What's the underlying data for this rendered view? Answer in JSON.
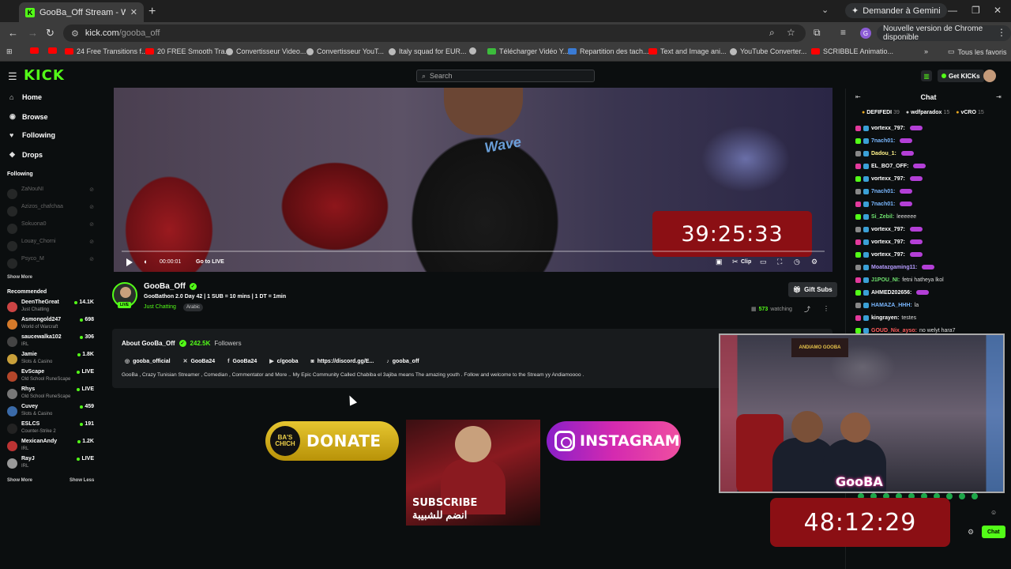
{
  "browser": {
    "tab_title": "GooBa_Off Stream - Watch Live",
    "tab_favicon": "K",
    "gemini_label": "Demander à Gemini",
    "url_host": "kick.com",
    "url_path": "/gooba_off",
    "profile_initial": "G",
    "update_label": "Nouvelle version de Chrome disponible",
    "bookmarks": [
      "24 Free Transitions f...",
      "20 FREE Smooth Tra...",
      "Convertisseur Video...",
      "Convertisseur YouT...",
      "Italy squad for EUR...",
      "Télécharger Vidéo Y...",
      "Repartition des tach...",
      "Text and Image ani...",
      "YouTube Converter...",
      "SCRIBBLE Animatio..."
    ],
    "all_bookmarks": "Tous les favoris"
  },
  "kick": {
    "logo": "KICK",
    "search_placeholder": "Search",
    "get_kicks": "Get KICKs"
  },
  "sidebar": {
    "nav": [
      {
        "icon": "⌂",
        "label": "Home"
      },
      {
        "icon": "◉",
        "label": "Browse"
      },
      {
        "icon": "♥",
        "label": "Following"
      },
      {
        "icon": "◆",
        "label": "Drops"
      }
    ],
    "following_title": "Following",
    "following": [
      {
        "name": "ZaNouNI"
      },
      {
        "name": "Azizos_chafchaa"
      },
      {
        "name": "Sokuona0"
      },
      {
        "name": "Louay_Chorni"
      },
      {
        "name": "Psyco_M"
      }
    ],
    "show_more": "Show More",
    "recommended_title": "Recommended",
    "recommended": [
      {
        "name": "DeenTheGreat",
        "category": "Just Chatting",
        "viewers": "14.1K",
        "color": "#c44"
      },
      {
        "name": "Asmongold247",
        "category": "World of Warcraft",
        "viewers": "698",
        "color": "#d57a2a"
      },
      {
        "name": "saucewalka102",
        "category": "IRL",
        "viewers": "306",
        "color": "#444"
      },
      {
        "name": "Jamie",
        "category": "Slots & Casino",
        "viewers": "1.8K",
        "color": "#c9a03a"
      },
      {
        "name": "EvScape",
        "category": "Old School RuneScape",
        "viewers": "LIVE",
        "color": "#b4462a"
      },
      {
        "name": "Rhys",
        "category": "Old School RuneScape",
        "viewers": "LIVE",
        "color": "#777"
      },
      {
        "name": "Cuvey",
        "category": "Slots & Casino",
        "viewers": "459",
        "color": "#3a6aa8"
      },
      {
        "name": "ESLCS",
        "category": "Counter-Strike 2",
        "viewers": "191",
        "color": "#222"
      },
      {
        "name": "MexicanAndy",
        "category": "IRL",
        "viewers": "1.2K",
        "color": "#b33"
      },
      {
        "name": "RayJ",
        "category": "IRL",
        "viewers": "LIVE",
        "color": "#999"
      }
    ],
    "show_more_2": "Show More",
    "show_less": "Show Less"
  },
  "player": {
    "shirt_text": "Wave",
    "timer": "39:25:33",
    "time": "00:00:01",
    "go_live": "Go to LIVE",
    "clip": "Clip"
  },
  "channel": {
    "name": "GooBa_Off",
    "live_badge": "LIVE",
    "title": "GooBathon 2.0 Day 42 | 1 SUB = 10 mins | 1 DT = 1min",
    "category": "Just Chatting",
    "tag": "Arabic",
    "gift_subs": "Gift Subs",
    "watching_count": "573",
    "watching_label": "watching"
  },
  "about": {
    "title": "About GooBa_Off",
    "followers_count": "242.5K",
    "followers_label": "Followers",
    "socials": [
      {
        "icon": "◎",
        "label": "gooba_official"
      },
      {
        "icon": "✕",
        "label": "GooBa24"
      },
      {
        "icon": "f",
        "label": "GooBa24"
      },
      {
        "icon": "▶",
        "label": "c/gooba"
      },
      {
        "icon": "◙",
        "label": "https://discord.gg/E..."
      },
      {
        "icon": "♪",
        "label": "gooba_off"
      }
    ],
    "bio": "GooBa , Crazy Tunisian Streamer , Comedian , Commentator and More .. My Epic Community Called Chabiba el 3ajiba means The amazing youth . Follow and welcome to the Stream yy Andiamoooo ."
  },
  "panels": {
    "donate_logo": "BA'S CHICH",
    "donate": "DONATE",
    "subscribe": "SUBSCRIBE",
    "subscribe_ar": "انضم للشبيبة",
    "instagram": "INSTAGRAM"
  },
  "chat": {
    "title": "Chat",
    "leaders": [
      {
        "name": "DEFIFEDI",
        "count": "39"
      },
      {
        "name": "wdfparadox",
        "count": "15"
      },
      {
        "name": "vCRO",
        "count": "15"
      }
    ],
    "messages": [
      {
        "user": "vortexx_797:",
        "color": "#fff",
        "text": ""
      },
      {
        "user": "7nach01:",
        "color": "#7ab8ff",
        "text": ""
      },
      {
        "user": "Dadou_1:",
        "color": "#fff38a",
        "text": ""
      },
      {
        "user": "EL_BO7_OFF:",
        "color": "#fff",
        "text": ""
      },
      {
        "user": "vortexx_797:",
        "color": "#fff",
        "text": ""
      },
      {
        "user": "7nach01:",
        "color": "#7ab8ff",
        "text": ""
      },
      {
        "user": "7nach01:",
        "color": "#7ab8ff",
        "text": ""
      },
      {
        "user": "Si_Zebil:",
        "color": "#6fe36f",
        "text": "leeeeee"
      },
      {
        "user": "vortexx_797:",
        "color": "#fff",
        "text": ""
      },
      {
        "user": "vortexx_797:",
        "color": "#fff",
        "text": ""
      },
      {
        "user": "vortexx_797:",
        "color": "#fff",
        "text": ""
      },
      {
        "user": "Moatazgaming11:",
        "color": "#b69cff",
        "text": ""
      },
      {
        "user": "J1POU_NI:",
        "color": "#6fe36f",
        "text": "fetni hatheya lkol"
      },
      {
        "user": "AHMED202656:",
        "color": "#fff",
        "text": ""
      },
      {
        "user": "HAMAZA_HHH:",
        "color": "#7ab8ff",
        "text": "la"
      },
      {
        "user": "kingrayen:",
        "color": "#fff",
        "text": "testes"
      },
      {
        "user": "GOUD_Nix_ayso:",
        "color": "#ff5b5b",
        "text": "no welyt hara7"
      }
    ],
    "cam_banner": "ANDIAMO GOOBA",
    "cam_brand": "GooBA",
    "timer": "48:12:29",
    "send": "Chat"
  }
}
